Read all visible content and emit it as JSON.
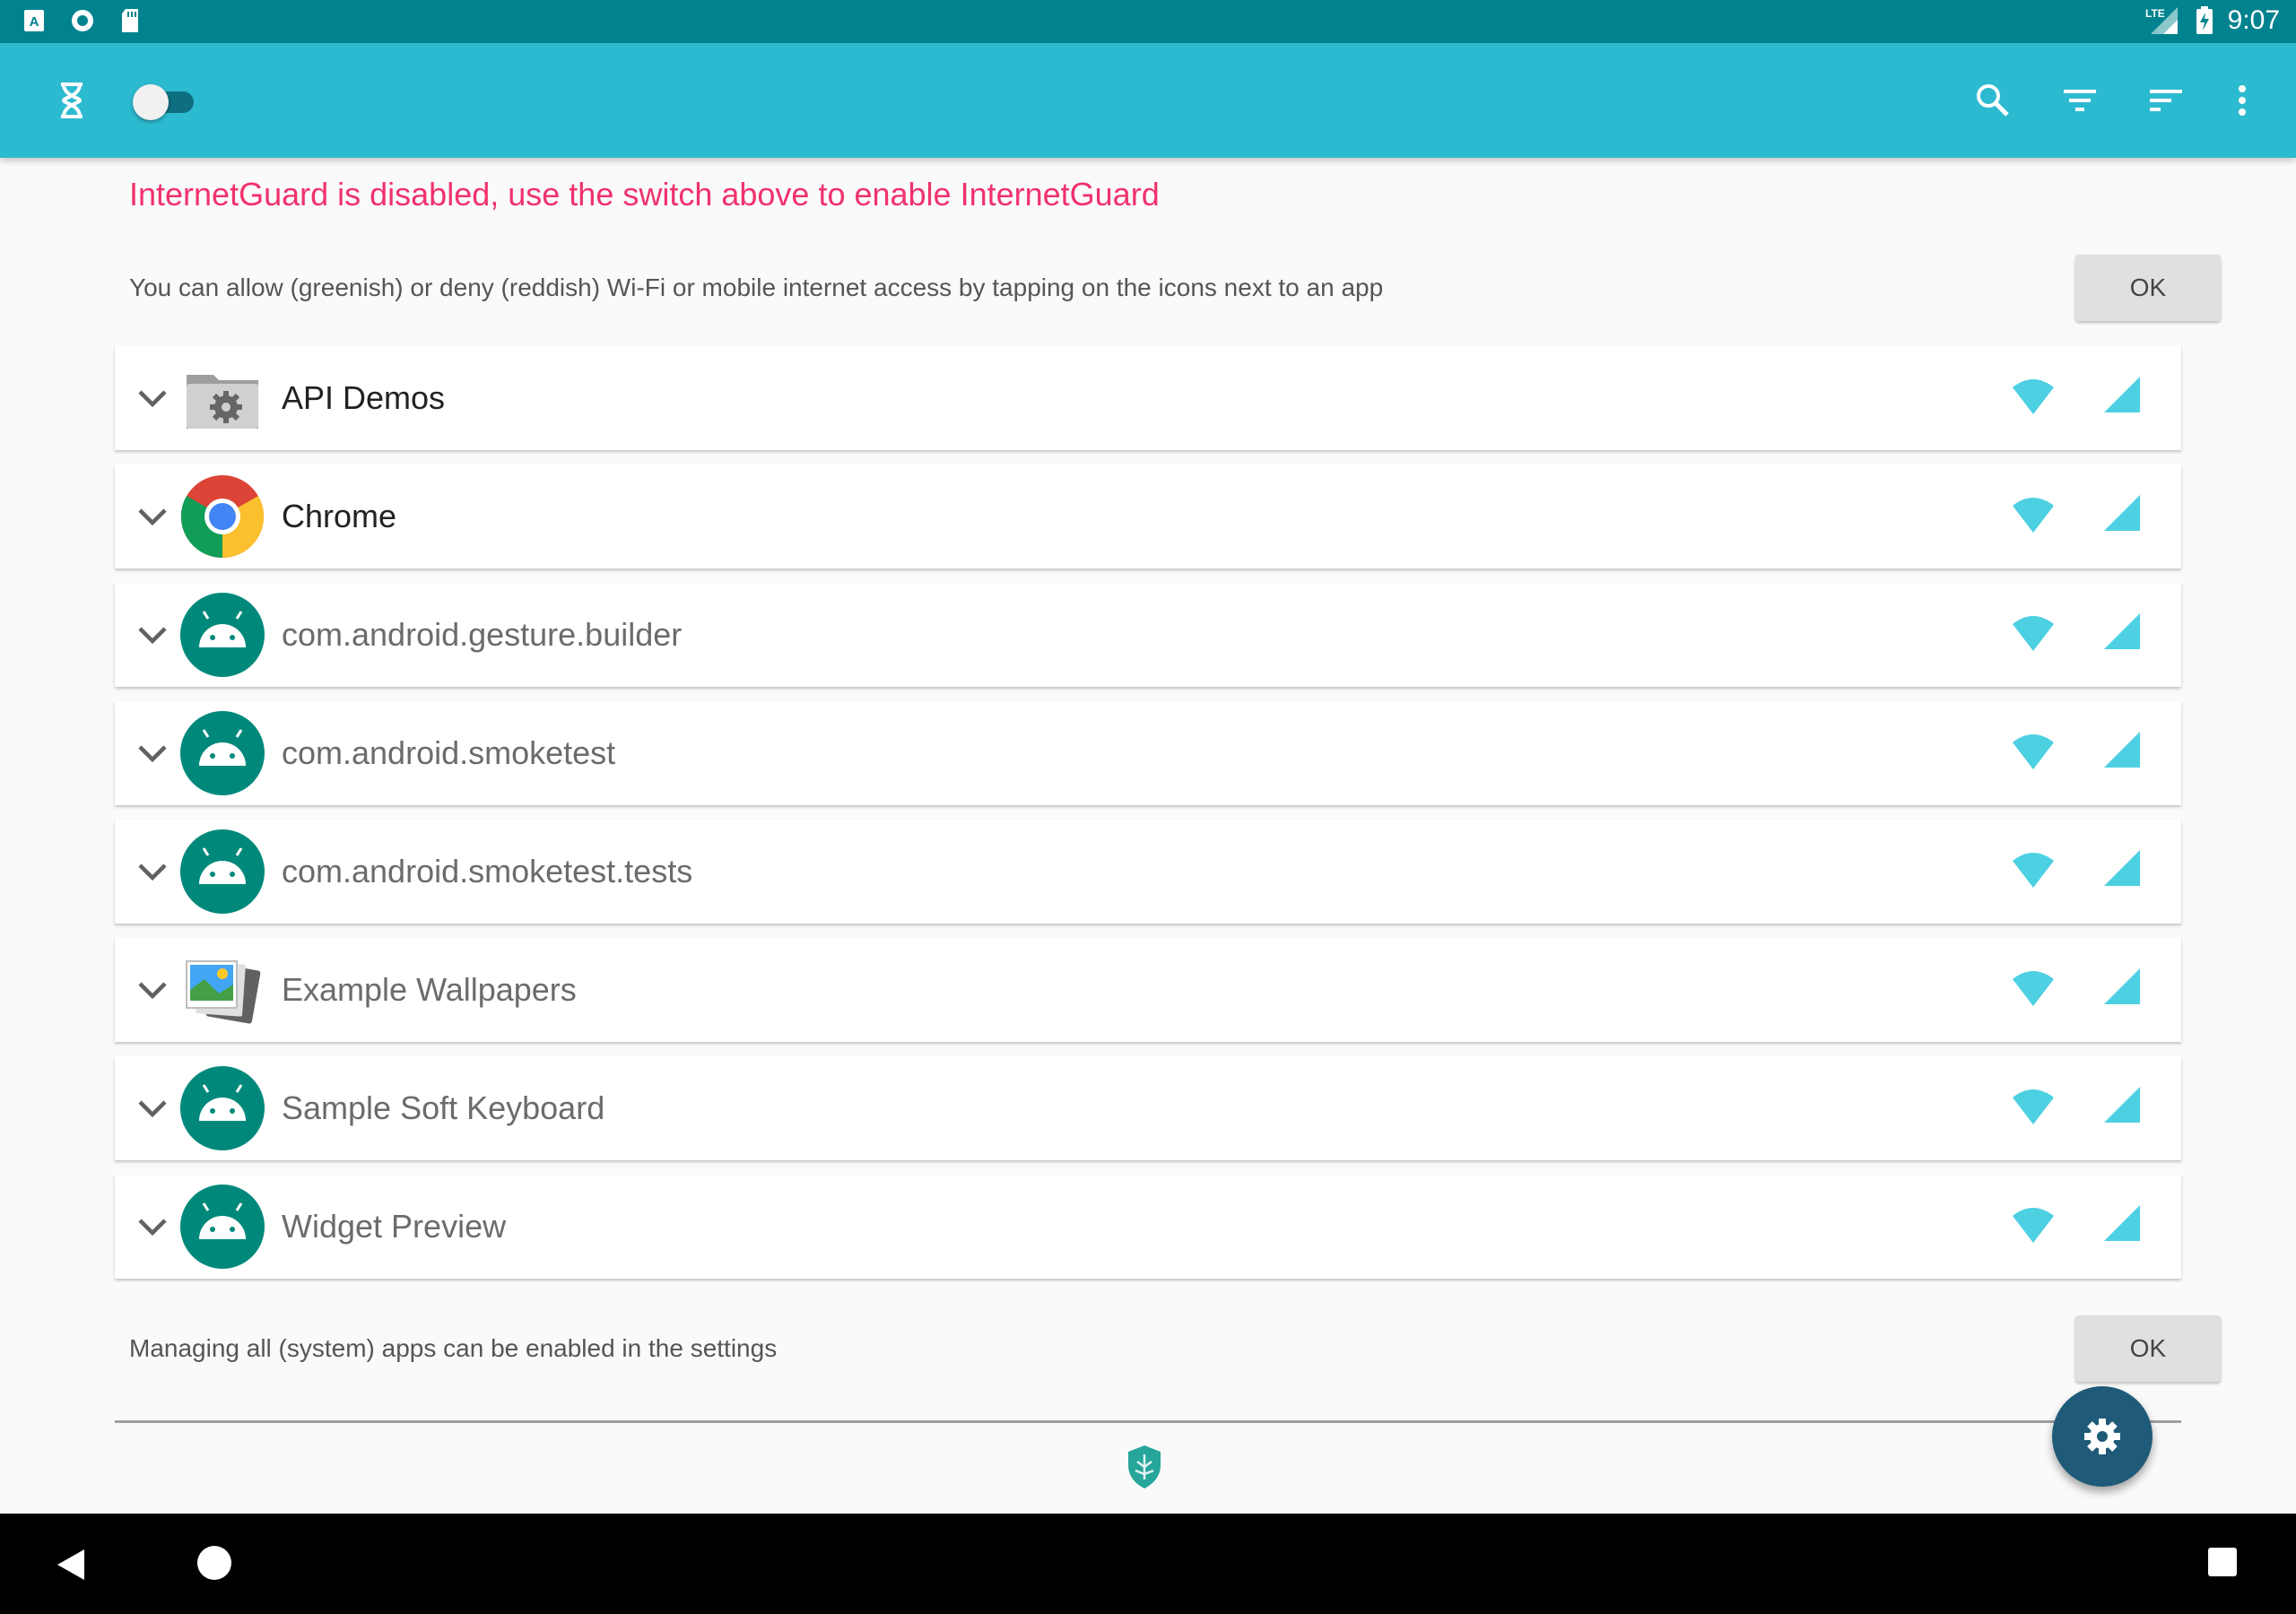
{
  "status_bar": {
    "time": "9:07",
    "network": "LTE",
    "left_icons": [
      "a-notification-icon",
      "circle-notification-icon",
      "sd-card-icon"
    ]
  },
  "toolbar": {
    "icons": [
      "hourglass-icon",
      "search-icon",
      "filter-icon",
      "sort-icon",
      "overflow-menu-icon"
    ],
    "switch_state": "off"
  },
  "warning": "InternetGuard is disabled, use the switch above to enable InternetGuard",
  "hint_top": {
    "text": "You can allow (greenish) or deny (reddish) Wi-Fi or mobile internet access by tapping on the icons next to an app",
    "ok": "OK"
  },
  "apps": [
    {
      "name": "API Demos",
      "icon": "folder-gear-icon"
    },
    {
      "name": "Chrome",
      "icon": "chrome-icon"
    },
    {
      "name": "com.android.gesture.builder",
      "icon": "android-icon"
    },
    {
      "name": "com.android.smoketest",
      "icon": "android-icon"
    },
    {
      "name": "com.android.smoketest.tests",
      "icon": "android-icon"
    },
    {
      "name": "Example Wallpapers",
      "icon": "wallpaper-icon"
    },
    {
      "name": "Sample Soft Keyboard",
      "icon": "android-icon"
    },
    {
      "name": "Widget Preview",
      "icon": "android-icon"
    }
  ],
  "hint_bottom": {
    "text": "Managing all (system) apps can be enabled in the settings",
    "ok": "OK"
  },
  "colors": {
    "toolbar": "#2cbad0",
    "status_bar": "#00838f",
    "warning": "#f0326c",
    "network_icon": "#4dd0e1",
    "fab": "#1f5a78"
  }
}
